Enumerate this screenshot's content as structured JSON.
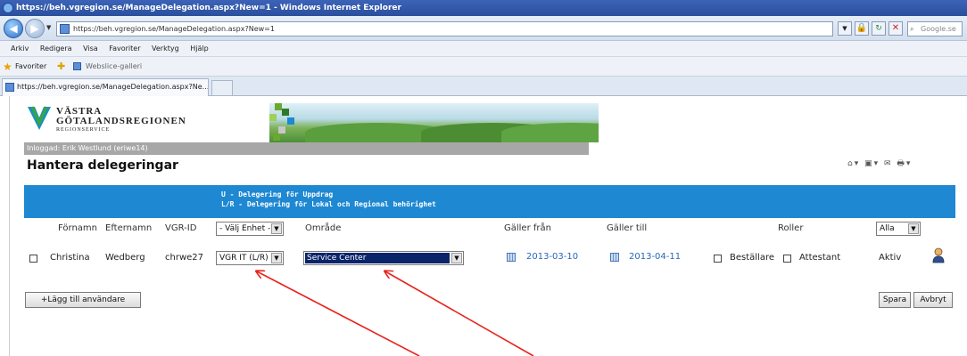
{
  "browser": {
    "title": "https://beh.vgregion.se/ManageDelegation.aspx?New=1 - Windows Internet Explorer",
    "address": "https://beh.vgregion.se/ManageDelegation.aspx?New=1",
    "search_placeholder": "Google.se",
    "menu": [
      "Arkiv",
      "Redigera",
      "Visa",
      "Favoriter",
      "Verktyg",
      "Hjälp"
    ],
    "favorites_label": "Favoriter",
    "webslice_label": "Webslice-galleri",
    "tab_title": "https://beh.vgregion.se/ManageDelegation.aspx?Ne..."
  },
  "header": {
    "logo_line1": "VÄSTRA",
    "logo_line2": "GÖTALANDSREGIONEN",
    "logo_line3": "REGIONSERVICE",
    "logged_in": "Inloggad: Erik Westlund (eriwe14)"
  },
  "page_title": "Hantera delegeringar",
  "legend": {
    "line1": "U - Delegering för Uppdrag",
    "line2": "L/R - Delegering för Lokal och Regional behörighet"
  },
  "columns": {
    "firstname": "Förnamn",
    "lastname": "Efternamn",
    "vgrid": "VGR-ID",
    "unit_select": "- Välj Enhet -",
    "area": "Område",
    "valid_from": "Gäller från",
    "valid_to": "Gäller till",
    "roles": "Roller",
    "filter_select": "Alla"
  },
  "row": {
    "firstname": "Christina",
    "lastname": "Wedberg",
    "vgrid": "chrwe27",
    "unit": "VGR IT (L/R)",
    "area": "Service Center",
    "valid_from": "2013-03-10",
    "valid_to": "2013-04-11",
    "role1": "Beställare",
    "role2": "Attestant",
    "status": "Aktiv"
  },
  "buttons": {
    "add_user": "+Lägg till användare",
    "save": "Spara",
    "cancel": "Avbryt"
  },
  "colors": {
    "blue_bar": "#1e88d2",
    "arrow": "#e8231c",
    "date_link": "#2a67b6"
  }
}
